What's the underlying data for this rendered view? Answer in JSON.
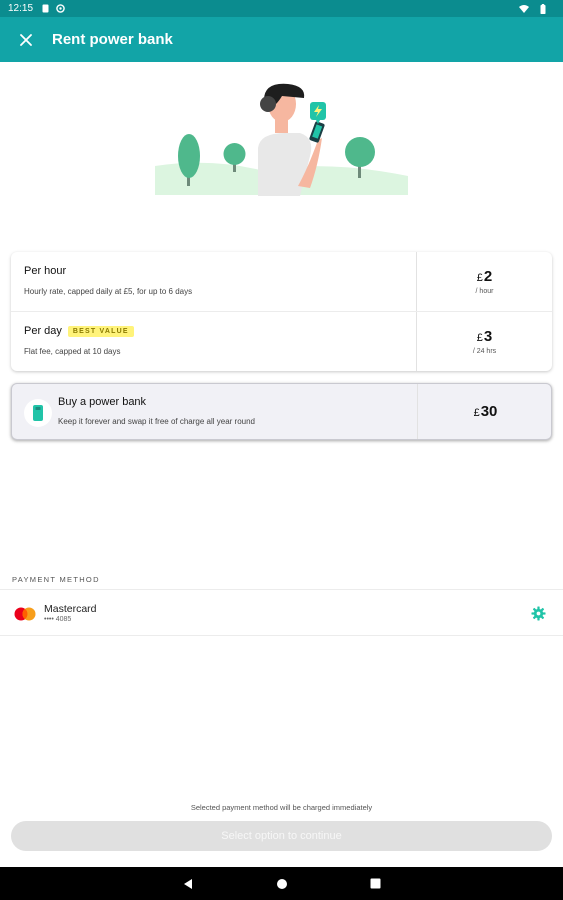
{
  "status_bar": {
    "time": "12:15"
  },
  "app_bar": {
    "title": "Rent power bank",
    "close_icon": "close-icon"
  },
  "rates": [
    {
      "name": "Per hour",
      "badge": "",
      "description": "Hourly rate, capped daily at £5, for up to 6 days",
      "currency": "£",
      "amount": "2",
      "unit": "/ hour"
    },
    {
      "name": "Per day",
      "badge": "BEST VALUE",
      "description": "Flat fee, capped at 10 days",
      "currency": "£",
      "amount": "3",
      "unit": "/ 24 hrs"
    }
  ],
  "buy": {
    "name": "Buy a power bank",
    "description": "Keep it forever and swap it free of charge all year round",
    "currency": "£",
    "amount": "30"
  },
  "payment": {
    "label": "PAYMENT METHOD",
    "brand": "Mastercard",
    "number": "•••• 4085",
    "settings_icon": "gear-icon"
  },
  "footer": {
    "note": "Selected payment method will be charged immediately",
    "button_label": "Select option to continue"
  },
  "colors": {
    "brand": "#12a4a7",
    "statusbar": "#0b8c8f",
    "badge_bg": "#fff37a",
    "icon_accent": "#21c4a8"
  }
}
